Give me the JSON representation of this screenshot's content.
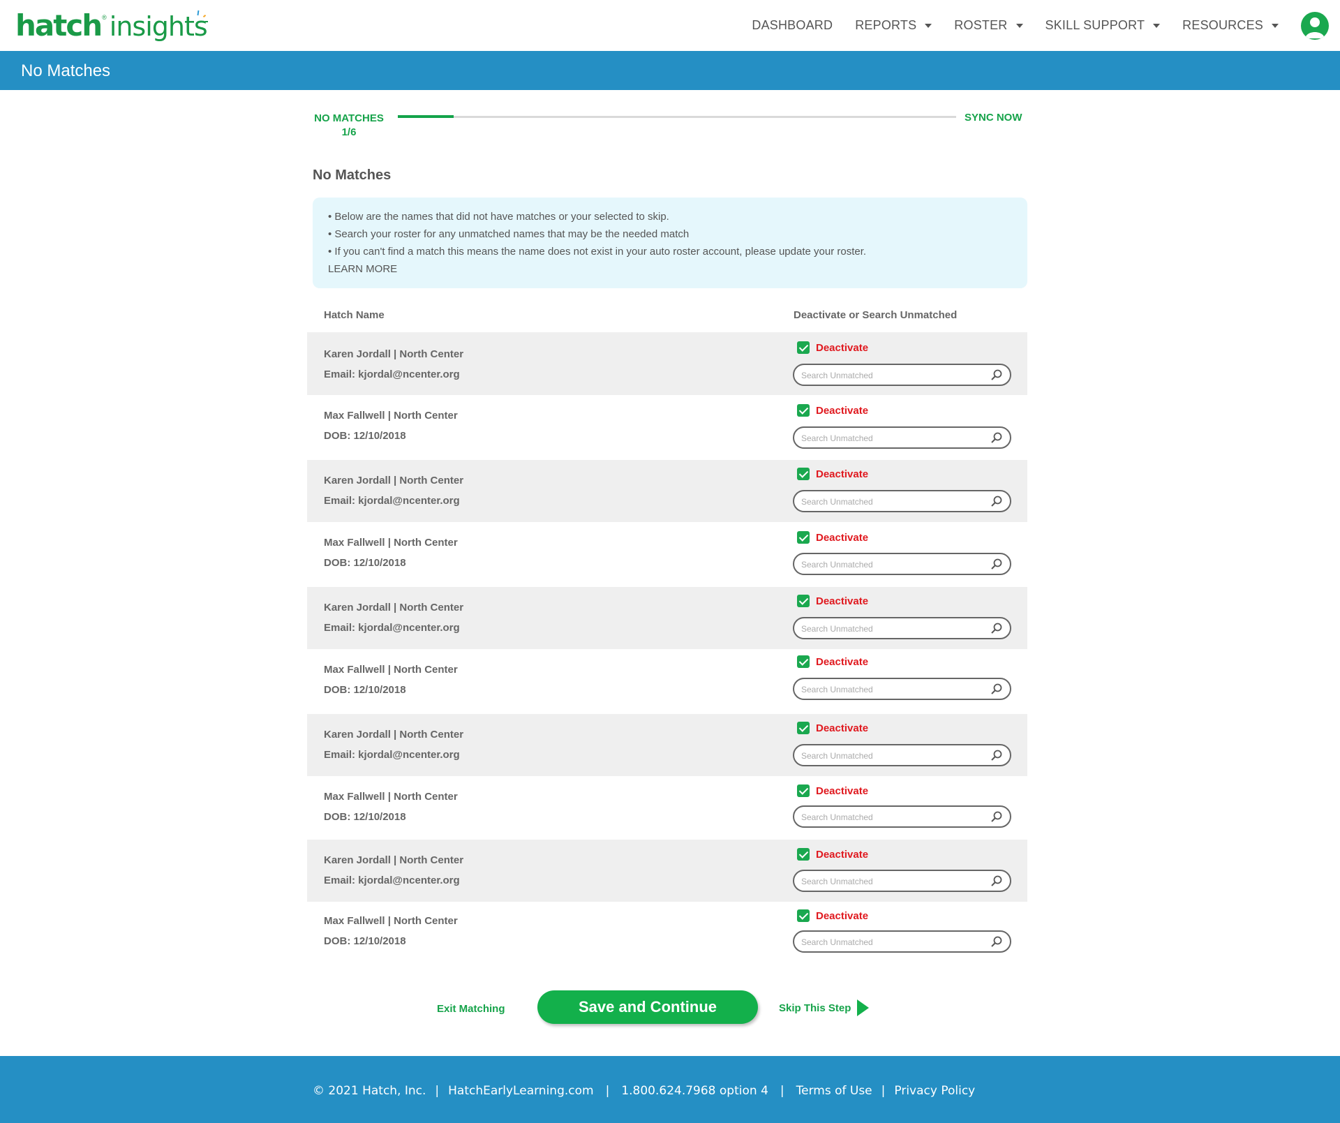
{
  "brand": {
    "name_bold": "hatch",
    "trademark": "®",
    "name_light": "insights"
  },
  "nav": [
    {
      "label": "DASHBOARD",
      "dropdown": false
    },
    {
      "label": "REPORTS",
      "dropdown": true
    },
    {
      "label": "ROSTER",
      "dropdown": true
    },
    {
      "label": "SKILL SUPPORT",
      "dropdown": true
    },
    {
      "label": "RESOURCES",
      "dropdown": true
    }
  ],
  "page_title": "No Matches",
  "progress": {
    "left_label": "NO MATCHES",
    "step_text": "1/6",
    "right_label": "SYNC NOW",
    "fraction": 0.1
  },
  "section_title": "No Matches",
  "info": {
    "lines": [
      "• Below are the names that did not have matches or your selected to skip.",
      "• Search your roster for any unmatched names that may be the needed match",
      "• If you can't find a match this means the name does not exist in your auto roster account, please update your roster."
    ],
    "learn_more": "LEARN MORE"
  },
  "table": {
    "col_name": "Hatch Name",
    "col_action": "Deactivate or Search  Unmatched",
    "deactivate_label": "Deactivate",
    "search_placeholder": "Search Unmatched",
    "rows": [
      {
        "name": "Karen Jordall | North Center",
        "detail": "Email: kjordal@ncenter.org",
        "checked": true
      },
      {
        "name": "Max Fallwell | North Center",
        "detail": "DOB: 12/10/2018",
        "checked": true
      },
      {
        "name": "Karen Jordall | North Center",
        "detail": "Email: kjordal@ncenter.org",
        "checked": true
      },
      {
        "name": "Max Fallwell | North Center",
        "detail": "DOB: 12/10/2018",
        "checked": true
      },
      {
        "name": "Karen Jordall | North Center",
        "detail": "Email: kjordal@ncenter.org",
        "checked": true
      },
      {
        "name": "Max Fallwell | North Center",
        "detail": "DOB: 12/10/2018",
        "checked": true
      },
      {
        "name": "Karen Jordall | North Center",
        "detail": "Email: kjordal@ncenter.org",
        "checked": true
      },
      {
        "name": "Max Fallwell | North Center",
        "detail": "DOB: 12/10/2018",
        "checked": true
      },
      {
        "name": "Karen Jordall | North Center",
        "detail": "Email: kjordal@ncenter.org",
        "checked": true
      },
      {
        "name": "Max Fallwell | North Center",
        "detail": "DOB: 12/10/2018",
        "checked": true
      }
    ]
  },
  "actions": {
    "exit": "Exit Matching",
    "save": "Save and Continue",
    "skip": "Skip This Step"
  },
  "footer": {
    "copyright": "© 2021 Hatch, Inc.",
    "site": "HatchEarlyLearning.com",
    "phone": "1.800.624.7968 option 4",
    "terms": "Terms of Use",
    "privacy": "Privacy Policy",
    "separator": "|"
  },
  "colors": {
    "brand_green": "#1a9a47",
    "header_blue": "#258fc4",
    "deactivate_red": "#e0191f",
    "info_bg": "#e5f7fc",
    "row_shade": "#efefef"
  },
  "icons": [
    "user-avatar-icon",
    "caret-down-icon",
    "checkbox-checked-icon",
    "search-icon",
    "play-arrow-icon"
  ]
}
